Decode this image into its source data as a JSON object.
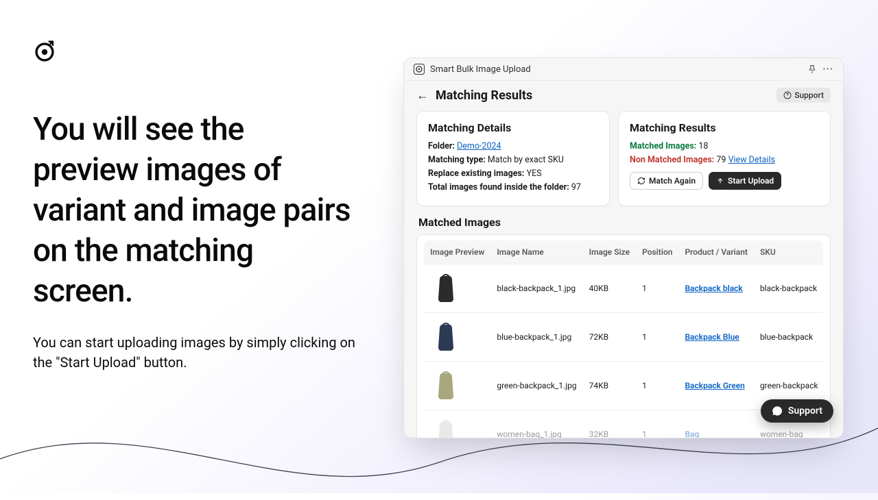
{
  "marketing": {
    "headline": "You will see the preview images of variant and image pairs on the matching screen.",
    "subtext": "You can start uploading images by simply clicking on the \"Start Upload\" button."
  },
  "app": {
    "title": "Smart Bulk Image Upload",
    "page_title": "Matching Results",
    "support_chip": "Support",
    "details": {
      "title": "Matching Details",
      "folder_label": "Folder:",
      "folder_link": "Demo-2024",
      "matching_type_label": "Matching type:",
      "matching_type_value": "Match by exact SKU",
      "replace_label": "Replace existing images:",
      "replace_value": "YES",
      "total_label": "Total images found inside the folder:",
      "total_value": "97"
    },
    "results": {
      "title": "Matching Results",
      "matched_label": "Matched Images:",
      "matched_value": "18",
      "nonmatched_label": "Non Matched Images:",
      "nonmatched_value": "79",
      "view_details": "View Details",
      "match_again": "Match Again",
      "start_upload": "Start Upload"
    },
    "table": {
      "section_title": "Matched Images",
      "headers": {
        "preview": "Image Preview",
        "name": "Image Name",
        "size": "Image Size",
        "position": "Position",
        "product": "Product / Variant",
        "sku": "SKU"
      },
      "rows": [
        {
          "name": "black-backpack_1.jpg",
          "size": "40KB",
          "position": "1",
          "product": "Backpack black",
          "sku": "black-backpack",
          "color": "#2b2b2b"
        },
        {
          "name": "blue-backpack_1.jpg",
          "size": "72KB",
          "position": "1",
          "product": "Backpack Blue",
          "sku": "blue-backpack",
          "color": "#2c3a54"
        },
        {
          "name": "green-backpack_1.jpg",
          "size": "74KB",
          "position": "1",
          "product": "Backpack Green",
          "sku": "green-backpack",
          "color": "#a9a77e"
        },
        {
          "name": "women-bag_1.jpg",
          "size": "32KB",
          "position": "1",
          "product": "Bag",
          "sku": "women-bag",
          "color": "#d0d0d0"
        }
      ]
    },
    "floating_support": "Support"
  }
}
